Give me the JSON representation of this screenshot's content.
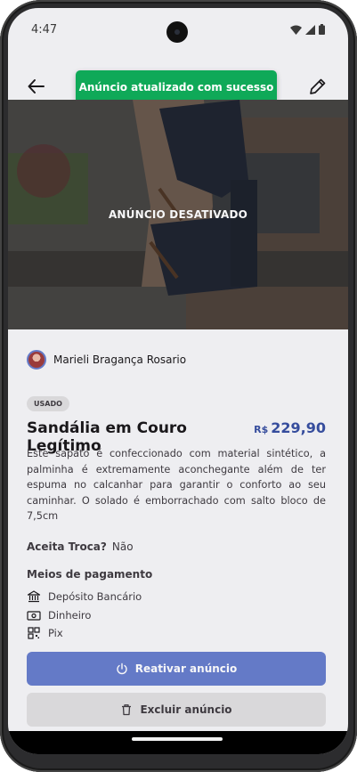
{
  "status_bar": {
    "time": "4:47"
  },
  "header": {
    "back_icon": "arrow-left-icon",
    "edit_icon": "pencil-icon",
    "toast": "Anúncio atualizado com sucesso"
  },
  "hero": {
    "overlay_label": "ANÚNCIO DESATIVADO"
  },
  "seller": {
    "name": "Marieli Bragança Rosario"
  },
  "product": {
    "condition": "USADO",
    "title": "Sandália em Couro Legítimo",
    "currency": "R$",
    "price": "229,90",
    "description": "Este sapato é confeccionado com material sintético, a palminha é extremamente aconchegante além de ter espuma no calcanhar para garantir o conforto ao seu caminhar. O solado é emborrachado com salto bloco de 7,5cm",
    "trade_label": "Aceita Troca?",
    "trade_value": "Não"
  },
  "payment": {
    "title": "Meios de pagamento",
    "methods": [
      {
        "label": "Depósito Bancário",
        "icon": "bank-icon"
      },
      {
        "label": "Dinheiro",
        "icon": "money-icon"
      },
      {
        "label": "Pix",
        "icon": "qr-code-icon"
      }
    ]
  },
  "actions": {
    "reactivate_label": "Reativar anúncio",
    "delete_label": "Excluir anúncio"
  },
  "colors": {
    "primary": "#647ac7",
    "price": "#364d9d",
    "toast": "#0fa958",
    "background": "#eeeef1"
  }
}
